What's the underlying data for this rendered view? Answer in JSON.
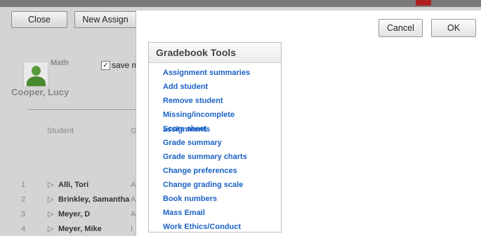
{
  "background": {
    "close_label": "Close",
    "new_assign_label": "New Assign",
    "subject": "Math",
    "save_label": "save m",
    "save_checked": "✓",
    "student_name": "Cooper, Lucy",
    "col_student": "Student",
    "col_grade": "G",
    "rows": [
      {
        "num": "1",
        "name": "Alli, Tori",
        "g": "A"
      },
      {
        "num": "2",
        "name": "Brinkley, Samantha",
        "g": "A"
      },
      {
        "num": "3",
        "name": "Meyer, D",
        "g": "A"
      },
      {
        "num": "4",
        "name": "Meyer, Mike",
        "g": "I"
      }
    ]
  },
  "dialog": {
    "cancel_label": "Cancel",
    "ok_label": "OK",
    "tools_title": "Gradebook Tools",
    "tools": [
      "Assignment summaries",
      "Add student",
      "Remove student",
      "Missing/incomplete assignments",
      "Score sheet",
      "Grade summary",
      "Grade summary charts",
      "Change preferences",
      "Change grading scale",
      "Book numbers",
      "Mass Email",
      "Work Ethics/Conduct"
    ]
  },
  "colors": {
    "link": "#1a62c6",
    "overlay_gray": "#d4d4d4",
    "accent_red": "#b02020"
  }
}
